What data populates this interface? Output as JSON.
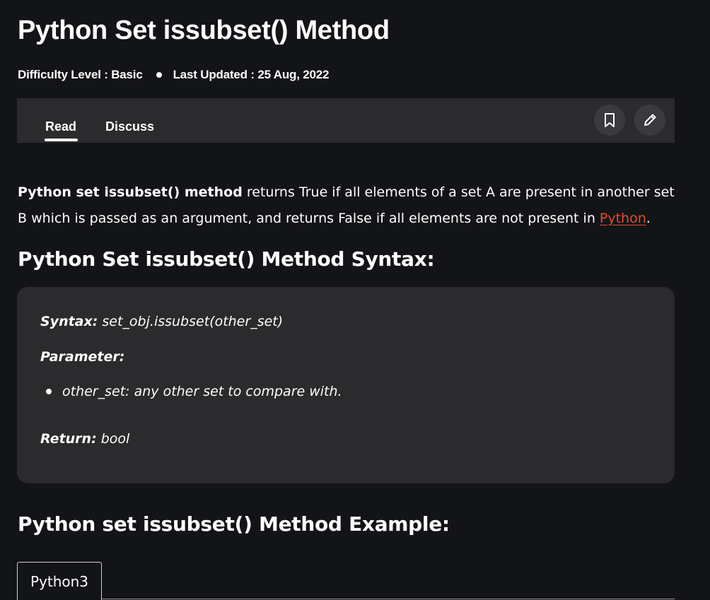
{
  "article": {
    "title": "Python Set issubset() Method",
    "difficulty": "Difficulty Level : Basic",
    "last_updated": "Last Updated : 25 Aug, 2022"
  },
  "tabs": {
    "read": "Read",
    "discuss": "Discuss",
    "active": "Read"
  },
  "actions": {
    "bookmark_icon": "bookmark-icon",
    "edit_icon": "pencil-icon"
  },
  "intro": {
    "bold_lead": "Python set issubset() method",
    "text": " returns True if all elements of a set A are present in another set B which is passed as an argument, and returns False if all elements are not present in ",
    "link_text": "Python",
    "tail": "."
  },
  "syntax_section": {
    "heading": "Python Set issubset() Method Syntax:",
    "syntax_label": "Syntax:",
    "syntax_value": " set_obj.issubset(other_set)",
    "parameter_label": "Parameter:",
    "parameters": [
      "other_set: any other set to compare with."
    ],
    "return_label": "Return:",
    "return_value": " bool"
  },
  "example_section": {
    "heading": "Python set issubset() Method Example:",
    "code_tab": "Python3"
  },
  "colors": {
    "background": "#131417",
    "panel": "#2b2b2e",
    "link": "#e34c2c",
    "text": "#ffffff"
  }
}
